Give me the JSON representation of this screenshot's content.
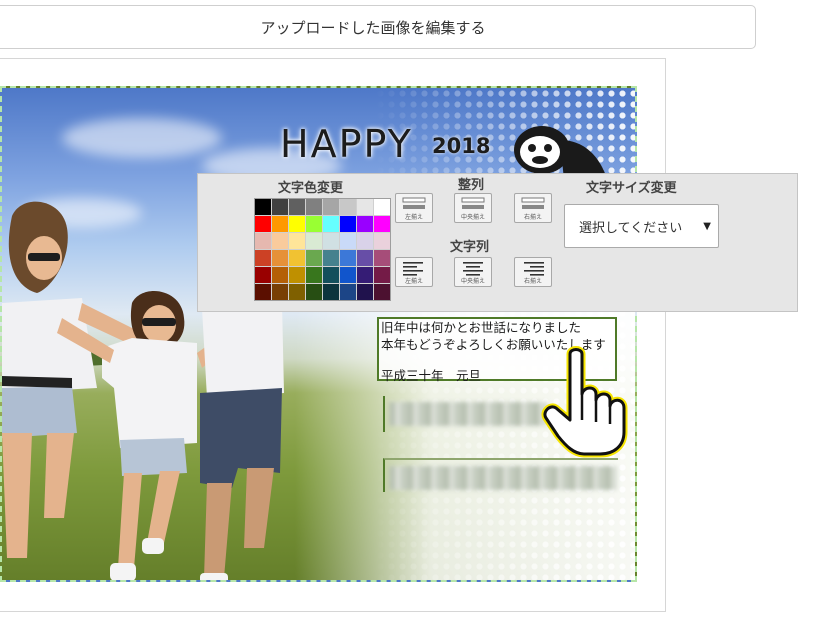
{
  "header": {
    "title": "アップロードした画像を編集する"
  },
  "card": {
    "happy_text": "HAPPY",
    "year_text": "2018",
    "greeting_lines": [
      "旧年中は何かとお世話になりました",
      "本年もどうぞよろしくお願いいたします",
      "平成三十年　元旦"
    ]
  },
  "toolbar": {
    "text_color_title": "文字色変更",
    "align_title": "整列",
    "text_column_title": "文字列",
    "font_size_title": "文字サイズ変更",
    "align_buttons": [
      "左揃え",
      "中央揃え",
      "右揃え"
    ],
    "column_buttons": [
      "左揃え",
      "中央揃え",
      "右揃え"
    ],
    "font_size_select": {
      "selected": "選択してください"
    },
    "palette_colors": [
      [
        "#000000",
        "#404040",
        "#606060",
        "#808080",
        "#a6a6a6",
        "#c8c8c8",
        "#e6e6e6",
        "#ffffff"
      ],
      [
        "#ff0000",
        "#ff9900",
        "#ffff00",
        "#99ff33",
        "#66ffff",
        "#0000ff",
        "#9900ff",
        "#ff00ff"
      ],
      [
        "#e6b8af",
        "#f9cb9c",
        "#ffe599",
        "#d9ead3",
        "#d0e0e3",
        "#c9daf8",
        "#d9d2e9",
        "#ead1dc"
      ],
      [
        "#cc4125",
        "#e69138",
        "#f1c232",
        "#6aa84f",
        "#45818e",
        "#3c78d8",
        "#674ea7",
        "#a64d79"
      ],
      [
        "#990000",
        "#b45f06",
        "#bf9000",
        "#38761d",
        "#134f5c",
        "#1155cc",
        "#351c75",
        "#741b47"
      ],
      [
        "#5b0f00",
        "#783f04",
        "#7f6000",
        "#274e13",
        "#0c343d",
        "#1c4587",
        "#20124d",
        "#4c1130"
      ]
    ]
  },
  "colors": {
    "card_border": "#b6e6a8",
    "selection_border": "#4f7a28",
    "cursor_outline": "#f5e400"
  },
  "icons": {
    "cursor": "hand-pointer-icon",
    "dog": "bulldog-icon",
    "caret": "caret-down-icon"
  }
}
